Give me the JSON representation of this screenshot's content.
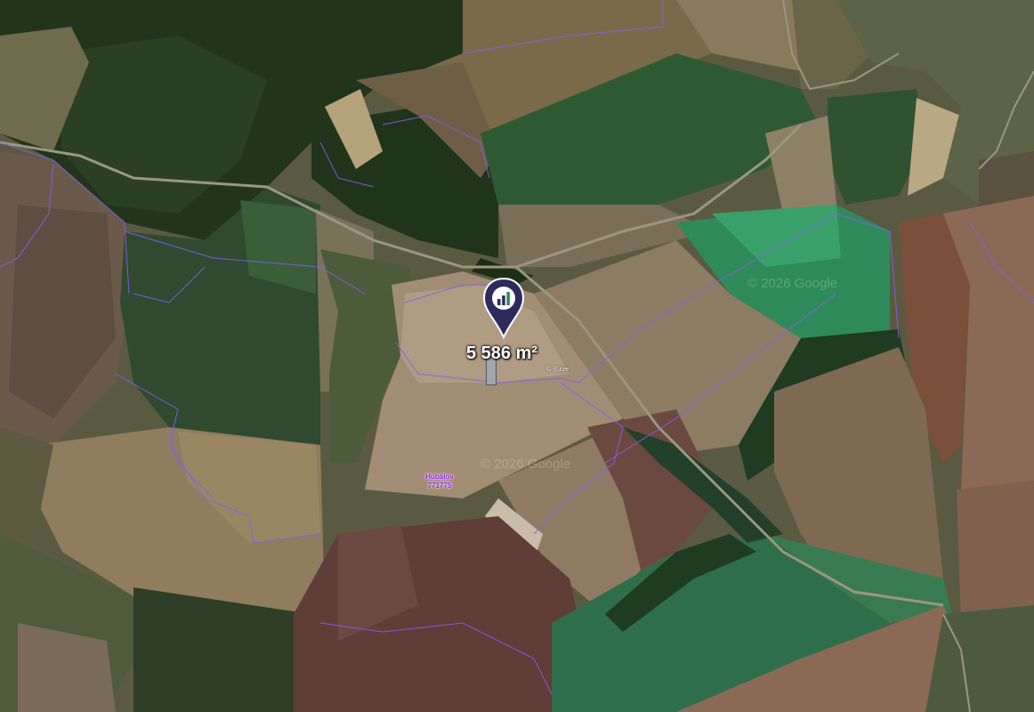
{
  "marker": {
    "area_label": "5 586 m²",
    "icon": "bar-chart-pin-icon",
    "color": "#2e2a5c"
  },
  "place": {
    "name": "Hubálov",
    "code": "771775",
    "color": "#8b1fd8"
  },
  "attribution": {
    "text_a": "© 2026 Google",
    "text_b": "© 2026 Google",
    "logo": "© Ⓖzze"
  },
  "colors": {
    "parcel_boundary": "#8a5cf0",
    "field_green": "#2f7a4a",
    "forest": "#22351b",
    "field_brown": "#8a7356"
  }
}
